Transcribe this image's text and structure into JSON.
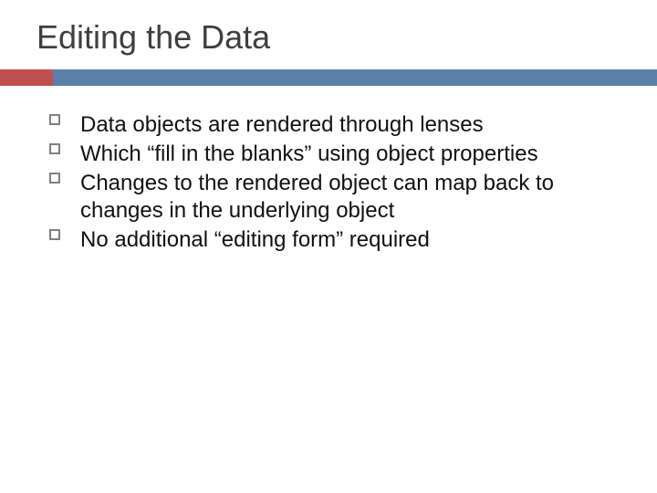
{
  "slide": {
    "title": "Editing the Data",
    "bullets": [
      "Data objects are rendered through lenses",
      "Which “fill in the blanks” using object properties",
      "Changes to the rendered object can map back to changes in the underlying object",
      "No additional “editing form” required"
    ]
  }
}
